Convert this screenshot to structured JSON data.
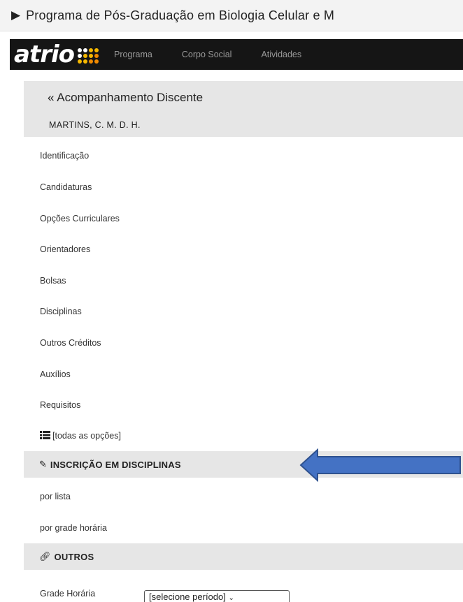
{
  "topbar": {
    "title": "Programa de Pós-Graduação em Biologia Celular e M"
  },
  "navbar": {
    "logo_text": "atrio",
    "logo_dot_colors": [
      "#ffffff",
      "#ffffff",
      "#f5b800",
      "#f5b800",
      "#ffffff",
      "#f5b800",
      "#f5b800",
      "#f08a00",
      "#f5b800",
      "#f5b800",
      "#f08a00",
      "#f08a00"
    ],
    "links": [
      "Programa",
      "Corpo Social",
      "Atividades"
    ]
  },
  "panel": {
    "back_label": "« Acompanhamento Discente",
    "student_name": "MARTINS, C. M. D. H."
  },
  "menu": [
    "Identificação",
    "Candidaturas",
    "Opções Curriculares",
    "Orientadores",
    "Bolsas",
    "Disciplinas",
    "Outros Créditos",
    "Auxílios",
    "Requisitos"
  ],
  "all_options": {
    "icon": "list-icon",
    "label": "[todas as opções]"
  },
  "inscricao": {
    "icon": "edit-icon",
    "title": "INSCRIÇÃO EM DISCIPLINAS",
    "items": [
      "por lista",
      "por grade horária"
    ]
  },
  "outros": {
    "icon": "link-icon",
    "title": "OUTROS",
    "grade_label": "Grade Horária",
    "select_value": "[selecione período]"
  },
  "colors": {
    "arrow_fill": "#4472c4",
    "arrow_stroke": "#2f528f"
  }
}
